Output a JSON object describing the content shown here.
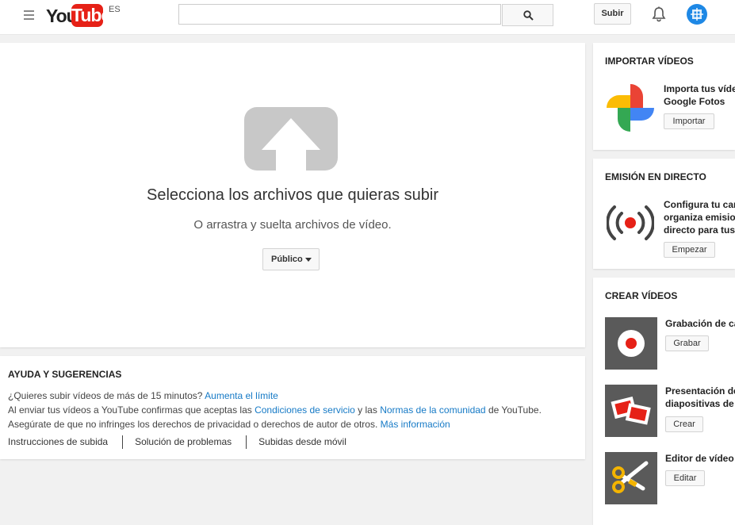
{
  "header": {
    "logo_you": "You",
    "logo_tube": "Tube",
    "lang_badge": "ES",
    "search_placeholder": "",
    "upload_label": "Subir"
  },
  "upload": {
    "title": "Selecciona los archivos que quieras subir",
    "subtitle": "O arrastra y suelta archivos de vídeo.",
    "privacy_label": "Público"
  },
  "help": {
    "title": "AYUDA Y SUGERENCIAS",
    "line1_text": "¿Quieres subir vídeos de más de 15 minutos?",
    "line1_link": "Aumenta el límite",
    "line2_pre": "Al enviar tus vídeos a YouTube confirmas que aceptas las",
    "line2_link1": "Condiciones de servicio",
    "line2_mid": "y las",
    "line2_link2": "Normas de la comunidad",
    "line2_post": "de YouTube.",
    "line3_text": "Asegúrate de que no infringes los derechos de privacidad o derechos de autor de otros.",
    "line3_link": "Más información",
    "links": [
      "Instrucciones de subida",
      "Solución de problemas",
      "Subidas desde móvil"
    ]
  },
  "sidebar": {
    "import": {
      "title": "IMPORTAR VÍDEOS",
      "text_line1": "Importa tus víde",
      "text_line2": "Google Fotos",
      "button": "Importar"
    },
    "live": {
      "title": "EMISIÓN EN DIRECTO",
      "text_line1": "Configura tu can",
      "text_line2": "organiza emision",
      "text_line3": "directo para tus",
      "button": "Empezar"
    },
    "create": {
      "title": "CREAR VÍDEOS",
      "items": [
        {
          "label_line1": "Grabación de cá",
          "label_line2": "",
          "button": "Grabar"
        },
        {
          "label_line1": "Presentación de",
          "label_line2": "diapositivas de",
          "button": "Crear"
        },
        {
          "label_line1": "Editor de vídeo",
          "label_line2": "",
          "button": "Editar"
        }
      ]
    }
  },
  "colors": {
    "brand_red": "#e62117",
    "link_blue": "#167ac6",
    "background": "#f1f1f1"
  }
}
